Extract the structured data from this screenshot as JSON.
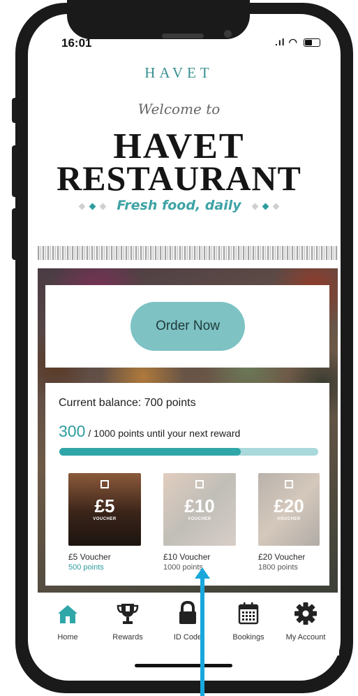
{
  "status_bar": {
    "time": "16:01",
    "signal": ".ıl",
    "wifi": "◠"
  },
  "header": {
    "brand": "HAVET",
    "welcome": "Welcome to",
    "title_line1": "HAVET",
    "title_line2": "RESTAURANT",
    "tagline": "Fresh food, daily"
  },
  "order": {
    "button_label": "Order Now"
  },
  "rewards": {
    "balance_text": "Current balance: 700 points",
    "remaining_points": "300",
    "remaining_text": "/ 1000 points until your next reward",
    "progress_fraction": 0.7,
    "vouchers": [
      {
        "amount": "£5",
        "badge": "VOUCHER",
        "name": "£5 Voucher",
        "points": "500 points",
        "available": true
      },
      {
        "amount": "£10",
        "badge": "VOUCHER",
        "name": "£10 Voucher",
        "points": "1000 points",
        "available": false
      },
      {
        "amount": "£20",
        "badge": "VOUCHER",
        "name": "£20 Voucher",
        "points": "1800 points",
        "available": false
      }
    ]
  },
  "tabs": [
    {
      "label": "Home",
      "icon": "home-icon",
      "active": true
    },
    {
      "label": "Rewards",
      "icon": "trophy-icon",
      "active": false
    },
    {
      "label": "ID Code",
      "icon": "lock-icon",
      "active": false
    },
    {
      "label": "Bookings",
      "icon": "calendar-icon",
      "active": false
    },
    {
      "label": "My Account",
      "icon": "gear-icon",
      "active": false
    }
  ],
  "colors": {
    "accent": "#2fa6a8",
    "button": "#7ec2c4",
    "arrow": "#1aa7dc"
  }
}
